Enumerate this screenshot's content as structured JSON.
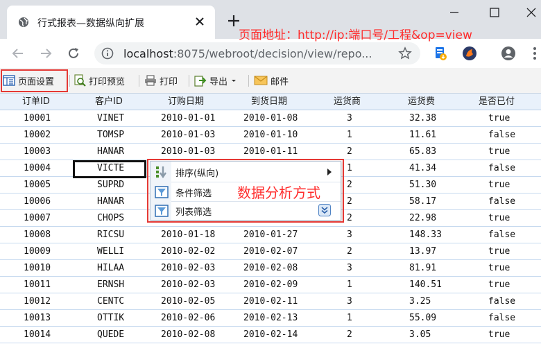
{
  "browser": {
    "tab_title": "行式报表—数据纵向扩展",
    "url_host": "localhost",
    "url_rest": ":8075/webroot/decision/view/repo..."
  },
  "annotations": {
    "url_note": "页面地址：http://ip:端口号/工程&op=view",
    "menu_note": "数据分析方式",
    "color": "#ff2b2b"
  },
  "report_toolbar": {
    "page_setup": "页面设置",
    "print_preview": "打印预览",
    "print": "打印",
    "export": "导出",
    "mail": "邮件"
  },
  "table": {
    "headers": [
      "订单ID",
      "客户ID",
      "订购日期",
      "到货日期",
      "运货商",
      "运货费",
      "是否已付"
    ],
    "rows": [
      [
        "10001",
        "VINET",
        "2010-01-01",
        "2010-01-08",
        "3",
        "32.38",
        "true"
      ],
      [
        "10002",
        "TOMSP",
        "2010-01-03",
        "2010-01-10",
        "1",
        "11.61",
        "false"
      ],
      [
        "10003",
        "HANAR",
        "2010-01-03",
        "2010-01-11",
        "2",
        "65.83",
        "true"
      ],
      [
        "10004",
        "VICTE",
        "",
        "",
        "1",
        "41.34",
        "false"
      ],
      [
        "10005",
        "SUPRD",
        "",
        "",
        "2",
        "51.30",
        "true"
      ],
      [
        "10006",
        "HANAR",
        "",
        "",
        "2",
        "58.17",
        "false"
      ],
      [
        "10007",
        "CHOPS",
        "",
        "",
        "2",
        "22.98",
        "true"
      ],
      [
        "10008",
        "RICSU",
        "2010-01-18",
        "2010-01-27",
        "3",
        "148.33",
        "false"
      ],
      [
        "10009",
        "WELLI",
        "2010-02-02",
        "2010-02-07",
        "2",
        "13.97",
        "true"
      ],
      [
        "10010",
        "HILAA",
        "2010-02-03",
        "2010-02-08",
        "3",
        "81.91",
        "true"
      ],
      [
        "10011",
        "ERNSH",
        "2010-02-03",
        "2010-02-09",
        "1",
        "140.51",
        "true"
      ],
      [
        "10012",
        "CENTC",
        "2010-02-05",
        "2010-02-11",
        "3",
        "3.25",
        "false"
      ],
      [
        "10013",
        "OTTIK",
        "2010-02-06",
        "2010-02-13",
        "1",
        "55.09",
        "false"
      ],
      [
        "10014",
        "QUEDE",
        "2010-02-08",
        "2010-02-14",
        "2",
        "3.05",
        "true"
      ]
    ]
  },
  "context_menu": {
    "sort": "排序(纵向)",
    "condition_filter": "条件筛选",
    "list_filter": "列表筛选"
  }
}
